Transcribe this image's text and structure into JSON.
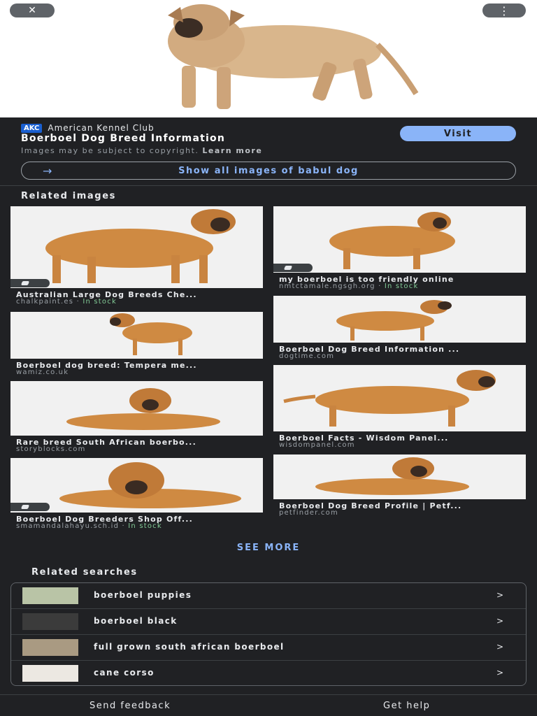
{
  "colors": {
    "background": "#202124",
    "accent": "#8ab4f8",
    "stock": "#81c995",
    "akc_badge": "#1a5fd0"
  },
  "top_bar": {
    "close_icon": "close-icon",
    "menu_icon": "more-vert-icon"
  },
  "source": {
    "badge": "AKC",
    "site_name": "American Kennel Club",
    "title": "Boerboel Dog Breed Information",
    "copyright": "Images may be subject to copyright.",
    "learn_more": "Learn more",
    "visit_label": "Visit"
  },
  "show_all": {
    "label": "Show all images of babul dog",
    "icon": "arrow-right-icon"
  },
  "related_images": {
    "heading": "Related images",
    "left": [
      {
        "caption": "Australian Large Dog Breeds Che...",
        "domain": "chalkpaint.es",
        "stock": "In stock"
      },
      {
        "caption": "Boerboel dog breed: Tempera me...",
        "domain": "wamiz.co.uk",
        "stock": ""
      },
      {
        "caption": "Rare breed South African boerbo...",
        "domain": "storyblocks.com",
        "stock": ""
      },
      {
        "caption": "Boerboel Dog Breeders Shop Off...",
        "domain": "smamandalahayu.sch.id",
        "stock": "In stock"
      }
    ],
    "right": [
      {
        "caption": "my boerboel is too friendly online",
        "domain": "nmtctamale.ngsgh.org",
        "stock": "In stock"
      },
      {
        "caption": "Boerboel Dog Breed Information ...",
        "domain": "dogtime.com",
        "stock": ""
      },
      {
        "caption": "Boerboel Facts - Wisdom Panel...",
        "domain": "wisdompanel.com",
        "stock": ""
      },
      {
        "caption": "Boerboel Dog Breed Profile | Petf...",
        "domain": "petfinder.com",
        "stock": ""
      }
    ]
  },
  "see_more": "SEE MORE",
  "related_searches": {
    "heading": "Related searches",
    "items": [
      {
        "label": "boerboel puppies",
        "chevron": ">"
      },
      {
        "label": "boerboel black",
        "chevron": ">"
      },
      {
        "label": "full grown south african boerboel",
        "chevron": ">"
      },
      {
        "label": "cane corso",
        "chevron": ">"
      }
    ]
  },
  "footer": {
    "feedback": "Send feedback",
    "help": "Get help"
  }
}
